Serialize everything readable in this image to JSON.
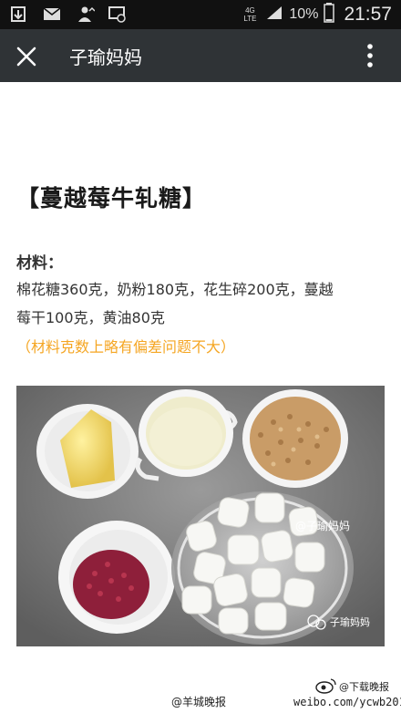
{
  "status_bar": {
    "network_label": "4G LTE",
    "battery_percent": "10%",
    "time": "21:57",
    "icons": [
      "download-icon",
      "mail-icon",
      "user-upload-icon",
      "screen-mirror-icon",
      "signal-icon",
      "battery-icon"
    ]
  },
  "app_bar": {
    "title": "子瑜妈妈",
    "close_icon": "close-icon",
    "menu_icon": "more-vert-icon",
    "background": "#2f3336"
  },
  "article": {
    "title": "【蔓越莓牛轧糖】",
    "materials_label": "材料：",
    "materials_line1": "棉花糖360克，奶粉180克，花生碎200克，蔓越",
    "materials_line2": "莓干100克，黄油80克",
    "note": "（材料克数上略有偏差问题不大）",
    "note_color": "#f5a623"
  },
  "photo": {
    "watermark_1": "@子瑜妈妈",
    "watermark_2": "子瑜妈妈"
  },
  "footer_watermark": {
    "name": "@下载晚报",
    "url": "weibo.com/ycwb2010",
    "paper": "@羊城晚报"
  }
}
